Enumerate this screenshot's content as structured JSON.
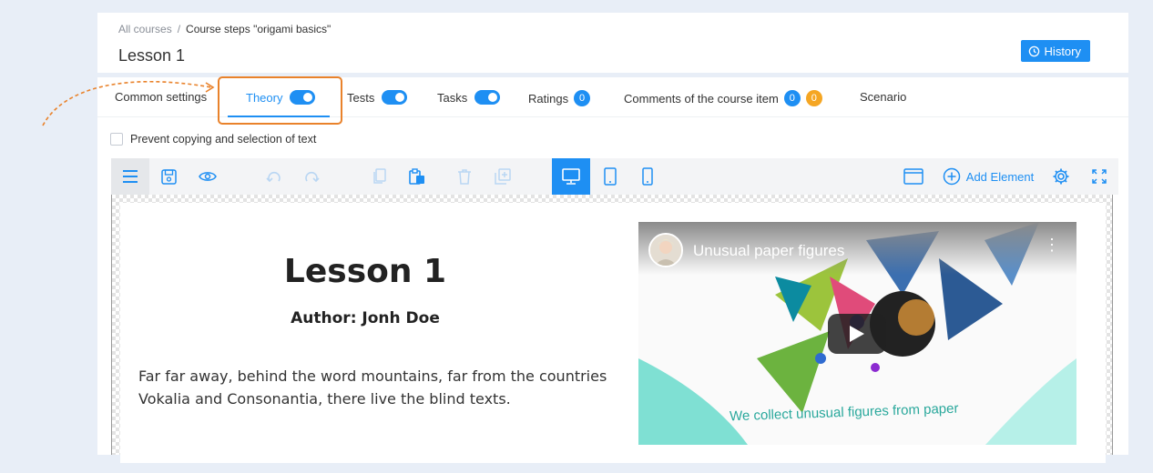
{
  "breadcrumb": {
    "root": "All courses",
    "separator": "/",
    "current": "Course steps \"origami basics\""
  },
  "page_title": "Lesson 1",
  "history_button": "History",
  "tabs": [
    {
      "label": "Common settings"
    },
    {
      "label": "Theory",
      "toggle": true,
      "active": true
    },
    {
      "label": "Tests",
      "toggle": true
    },
    {
      "label": "Tasks",
      "toggle": true
    },
    {
      "label": "Ratings",
      "badge": "0"
    },
    {
      "label": "Comments of the course item",
      "badge": "0",
      "badge2": "0"
    },
    {
      "label": "Scenario"
    }
  ],
  "prevent_copy_label": "Prevent copying and selection of text",
  "toolbar": {
    "add_element": "Add Element"
  },
  "lesson": {
    "title": "Lesson 1",
    "author": "Author: Jonh Doe",
    "body": "Far far away, behind the word mountains, far from the countries Vokalia and Consonantia, there live the blind texts."
  },
  "video": {
    "title": "Unusual paper figures",
    "caption": "We collect unusual figures from paper"
  },
  "colors": {
    "accent": "#1e8ff3",
    "highlight": "#e9822b",
    "badge_orange": "#f5a623"
  }
}
